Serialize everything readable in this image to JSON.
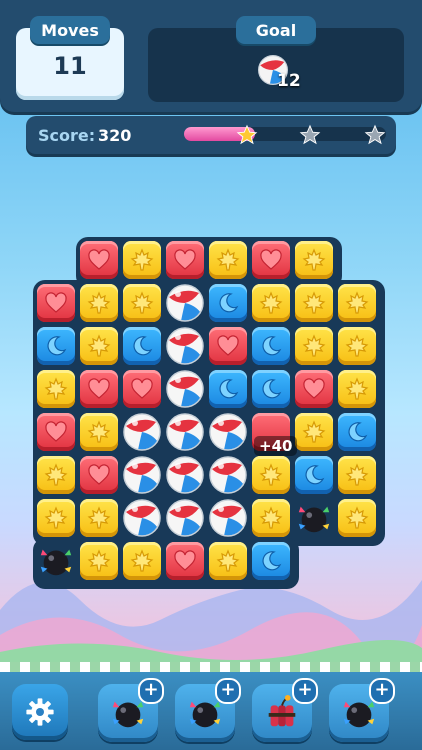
{
  "hud": {
    "moves_label": "Moves",
    "moves_value": "11",
    "goal_label": "Goal",
    "goal_item_icon": "beach-ball-icon",
    "goal_count": "12"
  },
  "score": {
    "label": "Score:",
    "value": "320",
    "progress_fraction": 0.35,
    "stars": [
      {
        "state": "earned",
        "color": "#ffc933"
      },
      {
        "state": "empty",
        "color": "#9aa6b2"
      },
      {
        "state": "empty",
        "color": "#9aa6b2"
      }
    ]
  },
  "board": {
    "tile_types": {
      "H": "red-heart",
      "L": "yellow-maple-leaf",
      "M": "blue-crescent-moon",
      "B": "beach-ball",
      "X": "bomb",
      "R": "red-empty"
    },
    "rows": [
      "-HLHLHL-",
      "HLLBMLLL",
      "MLMBHMLL",
      "LHHBMMHL",
      "HLBBBRLM",
      "LHBBBLML",
      "LLBBBLXL",
      "XLLHLM--"
    ],
    "popup_score": "+40"
  },
  "colors": {
    "red": "#e0313f",
    "yellow": "#f7bd12",
    "blue": "#1a86e0",
    "hud_dark": "#234c6e"
  },
  "dock": {
    "settings_icon": "gear-icon",
    "boosters": [
      {
        "name": "rainbow-bomb",
        "icon": "bomb-icon"
      },
      {
        "name": "bomb",
        "icon": "bomb-icon"
      },
      {
        "name": "dynamite",
        "icon": "dynamite-icon"
      },
      {
        "name": "spiked-bomb",
        "icon": "spiked-bomb-icon"
      }
    ],
    "add_label": "+"
  }
}
